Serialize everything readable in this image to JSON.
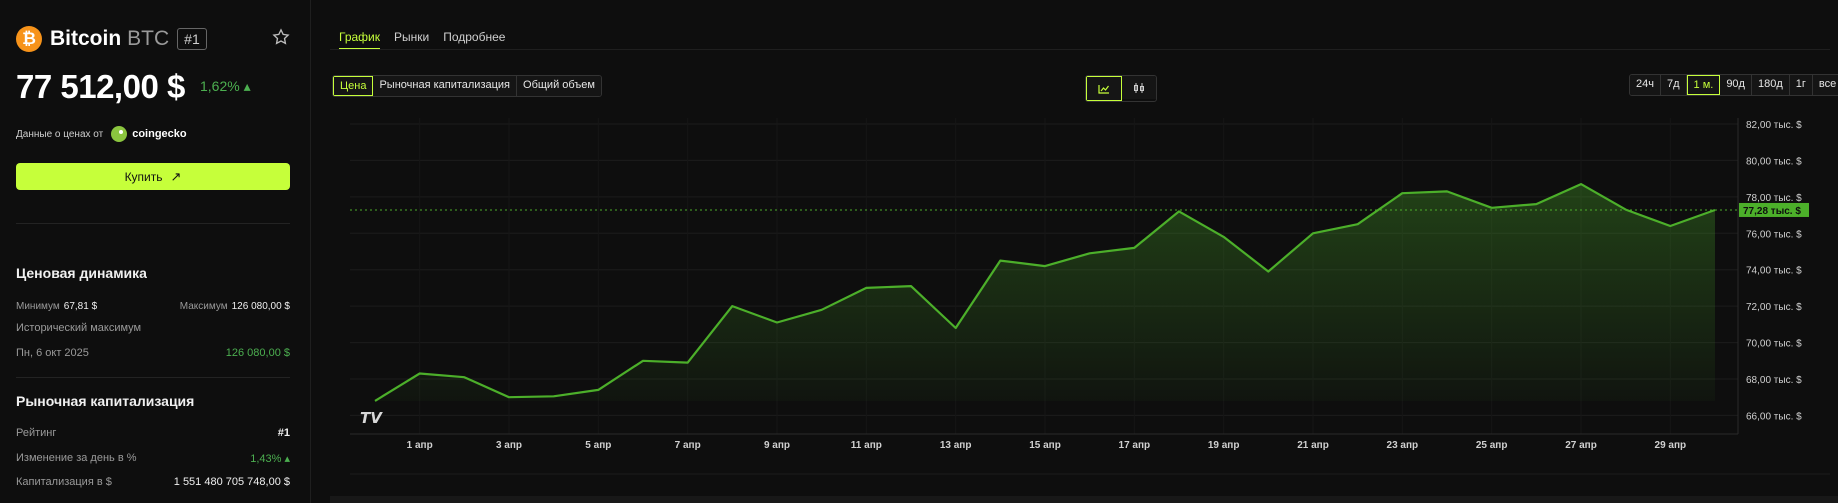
{
  "coin": {
    "logo_glyph": "₿",
    "name": "Bitcoin",
    "ticker": "BTC",
    "rank_badge": "#1",
    "price": "77 512,00 $",
    "change": "1,62% ▴",
    "provider_label": "Данные о ценах от",
    "provider_name": "coingecko",
    "buy_label": "Купить",
    "buy_icon": "↗"
  },
  "price_dynamics": {
    "title": "Ценовая динамика",
    "min_label": "Минимум",
    "min_value": "67,81 $",
    "max_label": "Максимум",
    "max_value": "126 080,00 $",
    "ath_label": "Исторический максимум",
    "ath_date": "Пн, 6 окт 2025",
    "ath_value": "126 080,00 $"
  },
  "market_cap": {
    "title": "Рыночная капитализация",
    "rank_label": "Рейтинг",
    "rank_value": "#1",
    "daychange_label": "Изменение за день в %",
    "daychange_value": "1,43% ▴",
    "cap_label": "Капитализация в $",
    "cap_value": "1 551 480 705 748,00 $"
  },
  "tabs": [
    {
      "label": "График",
      "active": true
    },
    {
      "label": "Рынки",
      "active": false
    },
    {
      "label": "Подробнее",
      "active": false
    }
  ],
  "metric_buttons": [
    {
      "label": "Цена",
      "active": true
    },
    {
      "label": "Рыночная капитализация",
      "active": false
    },
    {
      "label": "Общий объем",
      "active": false
    }
  ],
  "chart_type_buttons": [
    {
      "icon": "line-chart-icon",
      "active": true
    },
    {
      "icon": "candlestick-icon",
      "active": false
    }
  ],
  "range_buttons": [
    {
      "label": "24ч",
      "active": false
    },
    {
      "label": "7д",
      "active": false
    },
    {
      "label": "1 м.",
      "active": true
    },
    {
      "label": "90д",
      "active": false
    },
    {
      "label": "180д",
      "active": false
    },
    {
      "label": "1г",
      "active": false
    },
    {
      "label": "все",
      "active": false
    }
  ],
  "colors": {
    "accent": "#c6ff3a",
    "line": "#4caf2a",
    "positive": "#4caf50",
    "btc": "#f7931a"
  },
  "chart_data": {
    "type": "area",
    "x": [
      "31 мар",
      "1 апр",
      "2 апр",
      "3 апр",
      "4 апр",
      "5 апр",
      "6 апр",
      "7 апр",
      "8 апр",
      "9 апр",
      "10 апр",
      "11 апр",
      "12 апр",
      "13 апр",
      "14 апр",
      "15 апр",
      "16 апр",
      "17 апр",
      "18 апр",
      "19 апр",
      "20 апр",
      "21 апр",
      "22 апр",
      "23 апр",
      "24 апр",
      "25 апр",
      "26 апр",
      "27 апр",
      "28 апр",
      "29 апр",
      "30 апр"
    ],
    "values": [
      66.8,
      68.3,
      68.1,
      67.0,
      67.05,
      67.4,
      69.0,
      68.9,
      72.0,
      71.1,
      71.8,
      73.0,
      73.1,
      70.8,
      74.5,
      74.2,
      74.9,
      75.2,
      77.2,
      75.8,
      73.9,
      76.0,
      76.5,
      78.2,
      78.3,
      77.4,
      77.6,
      78.7,
      77.3,
      76.4,
      77.28
    ],
    "x_ticks": [
      "1 апр",
      "3 апр",
      "5 апр",
      "7 апр",
      "9 апр",
      "11 апр",
      "13 апр",
      "15 апр",
      "17 апр",
      "19 апр",
      "21 апр",
      "23 апр",
      "25 апр",
      "27 апр",
      "29 апр"
    ],
    "y_ticks": [
      "82,00 тыс. $",
      "80,00 тыс. $",
      "78,00 тыс. $",
      "76,00 тыс. $",
      "74,00 тыс. $",
      "72,00 тыс. $",
      "70,00 тыс. $",
      "68,00 тыс. $",
      "66,00 тыс. $"
    ],
    "ylim": [
      65.2,
      82.0
    ],
    "current_value": 77.28,
    "current_label": "77,28 тыс. $",
    "watermark": "TV"
  }
}
